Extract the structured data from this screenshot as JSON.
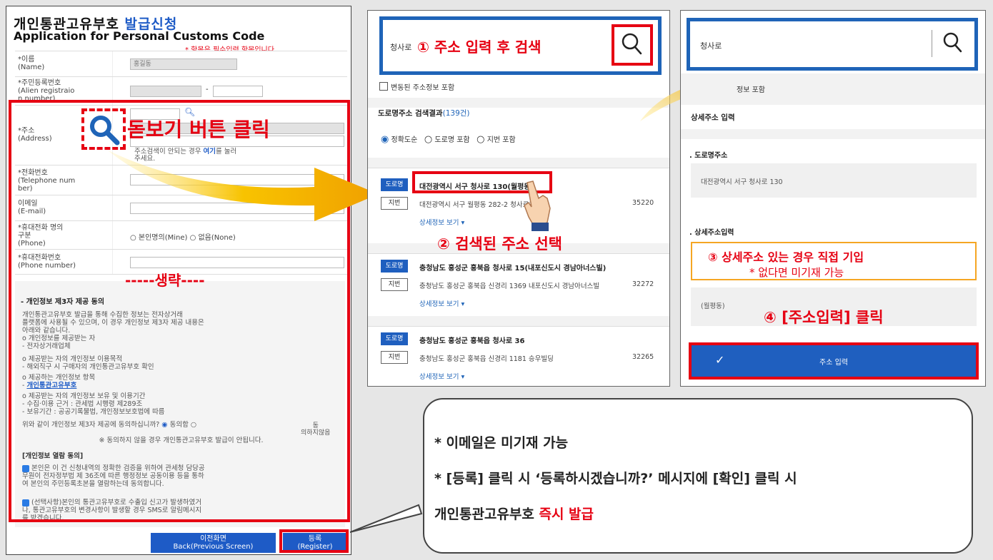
{
  "panel1": {
    "title_ko": "개인통관고유부호",
    "title_ko_accent": "발급신청",
    "title_en": "Application for Personal Customs Code",
    "required_note": "* 항목은 필수입력 항목입니다.",
    "fields": {
      "name_label": "*이름\n(Name)",
      "name_value": "홍길동",
      "id_label": "*주민등록번호\n(Alien registraio\nn number)",
      "id_dash": "-",
      "address_label": "*주소\n(Address)",
      "address_hint_pre": "주소검색이 안되는 경우 ",
      "address_hint_link": "여기",
      "address_hint_post": "를 눌러\n주세요.",
      "phone_label": "*전화번호\n(Telephone num\nber)",
      "email_label": "이메일\n(E-mail)",
      "mobile_owner_label": "*휴대전화 명의\n구분\n(Phone)",
      "mobile_owner_options": "○ 본인명의(Mine) ○ 없음(None)",
      "mobile_label": "*휴대전화번호\n(Phone number)"
    },
    "consent": {
      "heading": "- 개인정보 제3자 제공 동의",
      "intro": "개인통관고유부호 발급을 통해 수집한 정보는 전자상거래\n플랫폼에 사용될 수 있으며, 이 경우 개인정보 제3자 제공 내용은\n아래와 같습니다.\no 개인정보를 제공받는 자\n  - 전자상거래업체",
      "purpose": "o 제공받는 자의 개인정보 이용목적\n  - 해외직구 시 구매자의 개인통관고유부호 확인",
      "items_head": "o 제공하는 개인정보 항목\n  - ",
      "items_link": "개인통관고유부호",
      "retention": "o 제공받는 자의 개인정보 보유 및 이용기간\n  - 수집·이용 근거 : 관세법 시행령 제289조\n  - 보유기간 : 공공기록물법, 개인정보보호법에 따름",
      "question": "위와 같이 개인정보 제3자 제공에 동의하십니까?",
      "agree": "동의함",
      "disagree": "동\n의하지않음",
      "warning": "※ 동의하지 않을 경우 개인통관고유부호 발급이 안됩니다.",
      "view_heading": "[개인정보 열람 동의]",
      "view_text": "본인은 이 건 신청내역의 정확한 검증을 위하여 관세청 담당공\n무원이 전자정부법 제 36조에 따른 행정정보 공동이용 등을 통하\n여 본인의 주민등록초본을 열람하는데 동의합니다.",
      "sms_text": "(선택사항)본인의 통관고유부호로 수출입 신고가 발생하였거\n나, 통관고유부호의 변경사항이 발생할 경우 SMS로 알림메시지\n를 받겠습니다."
    },
    "btn_back": "이전화면\nBack(Previous Screen)",
    "btn_register": "등록\n(Register)",
    "callout_magnifier": "돋보기 버튼 클릭",
    "callout_omitted": "-----생략----"
  },
  "panel2": {
    "search_value": "청사로",
    "callout_search": "① 주소 입력 후 검색",
    "include_changed": "변동된 주소정보 포함",
    "result_title": "도로명주소 검색결과",
    "result_count": "(139건)",
    "sort_options": [
      "정확도순",
      "도로명 포함",
      "지번 포함"
    ],
    "tag_road": "도로명",
    "tag_lot": "지번",
    "detail_link": "상세정보 보기 ▾",
    "results": [
      {
        "road": "대전광역시 서구 청사로 130(월평동)",
        "lot": "대전광역시 서구 월평동 282-2 청사로프리",
        "zip": "35220"
      },
      {
        "road": "충청남도 홍성군 홍북읍 청사로 15(내포신도시 경남아너스빌)",
        "lot": "충청남도 홍성군 홍북읍 신경리 1369 내포신도시 경남아너스빌",
        "zip": "32272"
      },
      {
        "road": "충청남도 홍성군 홍북읍 청사로 36",
        "lot": "충청남도 홍성군 홍북읍 신경리 1181 승우빌딩",
        "zip": "32265"
      }
    ],
    "callout_select": "② 검색된 주소 선택"
  },
  "panel3": {
    "search_value": "청사로",
    "include_changed_partial": "정보 포함",
    "detail_heading": "상세주소 입력",
    "road_label": ". 도로명주소",
    "road_value": "대전광역시 서구 청사로 130",
    "detail_label": ". 상세주소입력",
    "callout_detail_1": "③ 상세주소 있는 경우 직접 기입",
    "callout_detail_2": "* 없다면 미기재 가능",
    "extra_value": "(월평동)",
    "callout_click": "④ [주소입력] 클릭",
    "submit_icon": "✓",
    "submit_label": "주소 입력"
  },
  "note": {
    "line1": "* 이메일은  미기재  가능",
    "line2": "* [등록] 클릭 시 ‘등록하시겠습니까?’ 메시지에  [확인] 클릭 시",
    "line3_pre": "개인통관고유부호 ",
    "line3_red": "즉시 발급"
  },
  "colors": {
    "accent_red": "#e60012",
    "brand_blue": "#1f64b8",
    "arrow": "#f5b800"
  }
}
